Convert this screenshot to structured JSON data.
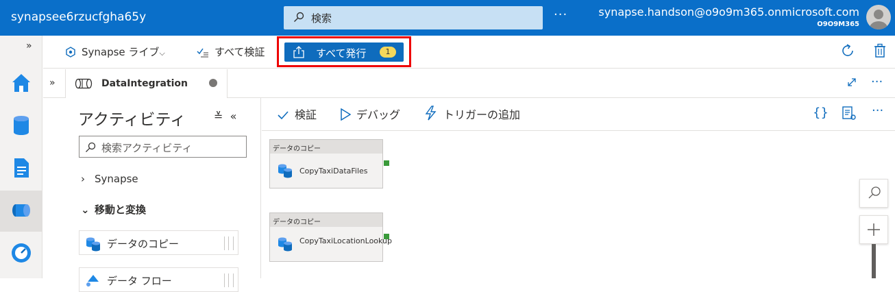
{
  "topbar": {
    "workspace_name": "synapsee6rzucfgha65y",
    "search_placeholder": "検索",
    "more": "···",
    "user_email": "synapse.handson@o9o9m365.onmicrosoft.com",
    "user_tenant": "O9O9M365"
  },
  "toolbar": {
    "synapse_live": "Synapse ライブ",
    "validate_all": "すべて検証",
    "publish_all": "すべて発行",
    "publish_count": "1"
  },
  "tab": {
    "name": "DataIntegration"
  },
  "activities": {
    "title": "アクティビティ",
    "search_placeholder": "検索アクティビティ",
    "categories": [
      {
        "label": "Synapse",
        "expanded": false
      },
      {
        "label": "移動と変換",
        "expanded": true
      }
    ],
    "items": [
      {
        "label": "データのコピー"
      },
      {
        "label": "データ フロー"
      }
    ]
  },
  "canvas_toolbar": {
    "validate": "検証",
    "debug": "デバッグ",
    "add_trigger": "トリガーの追加"
  },
  "nodes": [
    {
      "header": "データのコピー",
      "label": "CopyTaxiDataFiles"
    },
    {
      "header": "データのコピー",
      "label": "CopyTaxiLocationLookup"
    }
  ],
  "colors": {
    "topbar": "#0a6fc9",
    "primary_button": "#0f6cbd",
    "badge": "#f6d85b",
    "highlight_border": "#ee0000",
    "success_port": "#3a9a3a"
  }
}
